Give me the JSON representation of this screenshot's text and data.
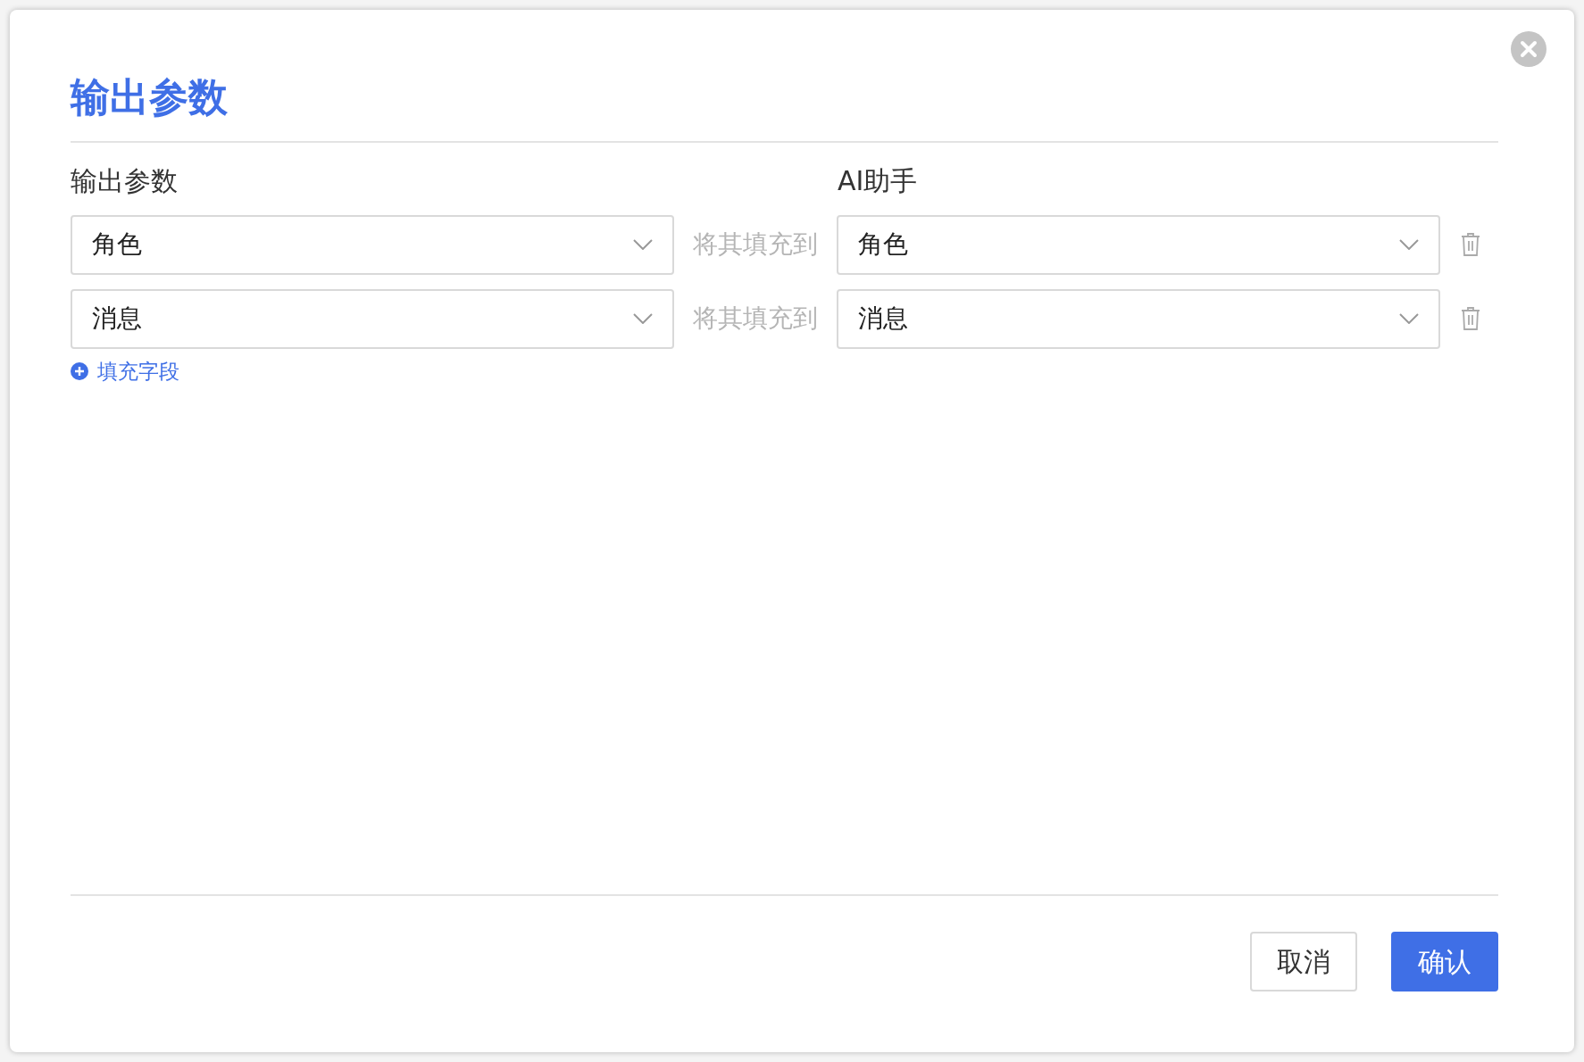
{
  "dialog": {
    "title": "输出参数"
  },
  "columns": [
    "输出参数",
    "AI助手"
  ],
  "mappings": [
    {
      "source": "角色",
      "connector": "将其填充到",
      "target": "角色"
    },
    {
      "source": "消息",
      "connector": "将其填充到",
      "target": "消息"
    }
  ],
  "add_field": "填充字段",
  "buttons": [
    {
      "label": "取消",
      "kind": "secondary"
    },
    {
      "label": "确认",
      "kind": "primary"
    }
  ]
}
